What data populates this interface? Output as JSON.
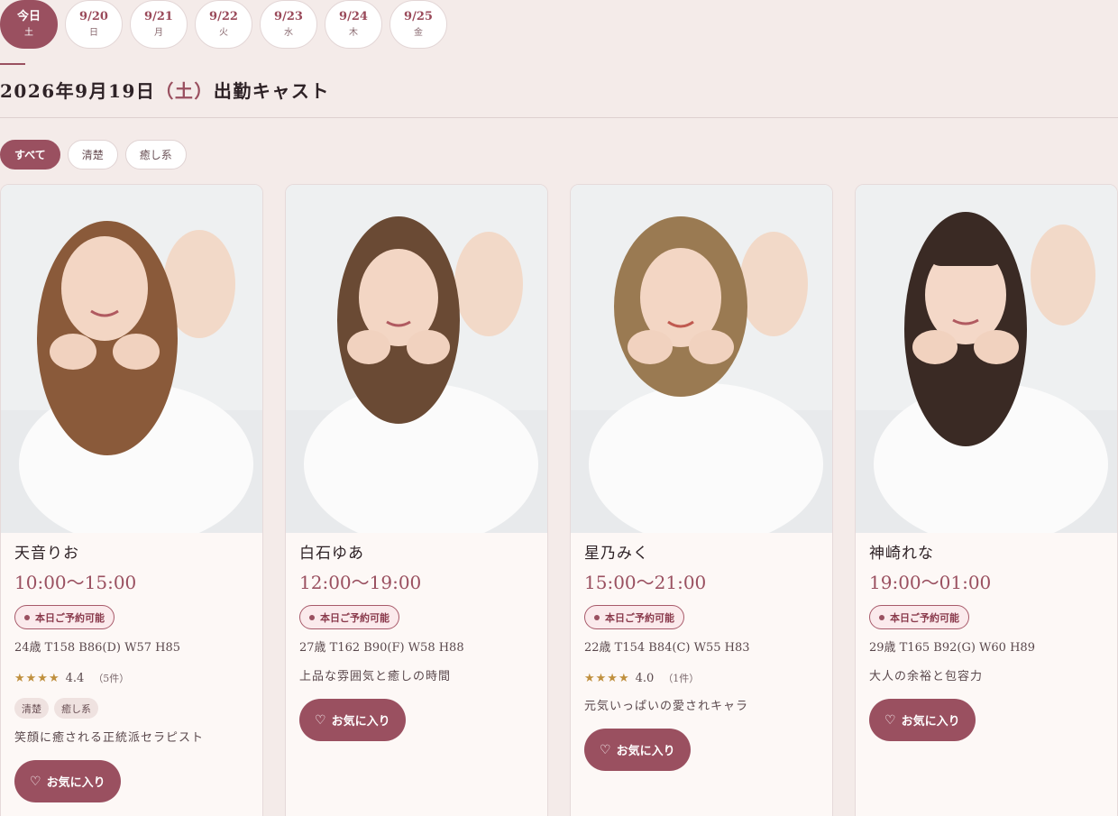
{
  "date_tabs": [
    {
      "date": "今日",
      "weekday": "土",
      "active": true
    },
    {
      "date": "9/20",
      "weekday": "日"
    },
    {
      "date": "9/21",
      "weekday": "月"
    },
    {
      "date": "9/22",
      "weekday": "火"
    },
    {
      "date": "9/23",
      "weekday": "水"
    },
    {
      "date": "9/24",
      "weekday": "木"
    },
    {
      "date": "9/25",
      "weekday": "金"
    }
  ],
  "page_title": {
    "date": "2026年9月19日",
    "weekday": "（土）",
    "suffix": "出勤キャスト"
  },
  "filters": [
    {
      "label": "すべて",
      "active": true
    },
    {
      "label": "清楚"
    },
    {
      "label": "癒し系"
    }
  ],
  "colors": {
    "accent": "#9a5060",
    "background": "#f4ebe9",
    "card": "#fdf8f6",
    "star": "#c0903e"
  },
  "casts": [
    {
      "name": "天音りお",
      "hours": "10:00〜15:00",
      "badge": "本日ご予約可能",
      "stats": "24歳 T158 B86(D) W57 H85",
      "stars": "★★★★",
      "score": "4.4",
      "review_count": "（5件）",
      "tags": [
        "清楚",
        "癒し系"
      ],
      "description": "笑顔に癒される正統派セラピスト",
      "favorite_label": "お気に入り",
      "hair_color": "#8a5a3a"
    },
    {
      "name": "白石ゆあ",
      "hours": "12:00〜19:00",
      "badge": "本日ご予約可能",
      "stats": "27歳 T162 B90(F) W58 H88",
      "description": "上品な雰囲気と癒しの時間",
      "favorite_label": "お気に入り",
      "hair_color": "#6a4a34"
    },
    {
      "name": "星乃みく",
      "hours": "15:00〜21:00",
      "badge": "本日ご予約可能",
      "stats": "22歳 T154 B84(C) W55 H83",
      "stars": "★★★★",
      "score": "4.0",
      "review_count": "（1件）",
      "description": "元気いっぱいの愛されキャラ",
      "favorite_label": "お気に入り",
      "hair_color": "#9a7a52"
    },
    {
      "name": "神崎れな",
      "hours": "19:00〜01:00",
      "badge": "本日ご予約可能",
      "stats": "29歳 T165 B92(G) W60 H89",
      "description": "大人の余裕と包容力",
      "favorite_label": "お気に入り",
      "hair_color": "#3a2a24"
    }
  ]
}
